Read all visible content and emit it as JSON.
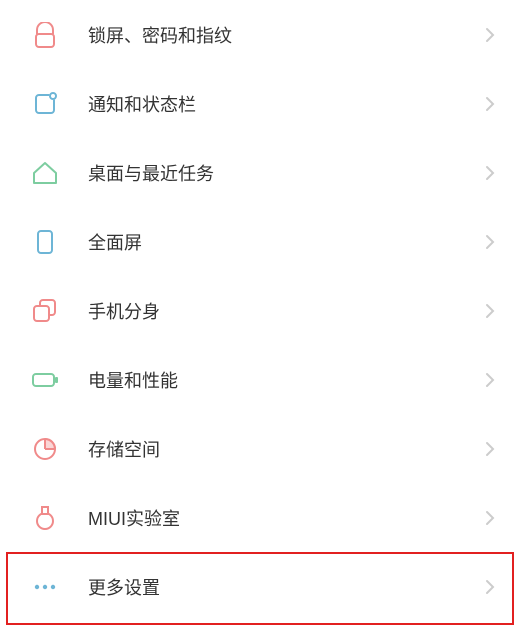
{
  "settings": {
    "items": [
      {
        "icon": "lock",
        "label": "锁屏、密码和指纹"
      },
      {
        "icon": "notification",
        "label": "通知和状态栏"
      },
      {
        "icon": "home",
        "label": "桌面与最近任务"
      },
      {
        "icon": "screen",
        "label": "全面屏"
      },
      {
        "icon": "clone",
        "label": "手机分身"
      },
      {
        "icon": "battery",
        "label": "电量和性能"
      },
      {
        "icon": "storage",
        "label": "存储空间"
      },
      {
        "icon": "lab",
        "label": "MIUI实验室"
      },
      {
        "icon": "more",
        "label": "更多设置",
        "highlighted": true
      }
    ]
  },
  "colors": {
    "iconRed": "#f08a8a",
    "iconBlue": "#6db5d6",
    "iconGreen": "#7dcda0",
    "chevron": "#cccccc",
    "highlight": "#e22020"
  }
}
